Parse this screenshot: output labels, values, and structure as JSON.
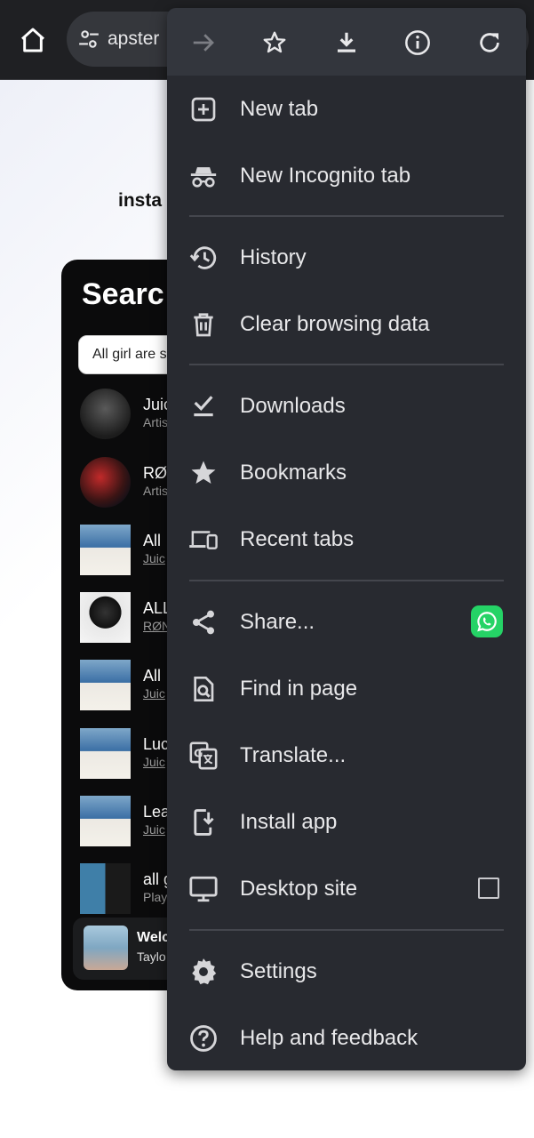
{
  "browser": {
    "url_text": "apster",
    "icons": [
      "home-icon",
      "site-settings-icon"
    ]
  },
  "page": {
    "install_text": "insta",
    "app": {
      "search_title": "Searc",
      "search_value": "All girl are s",
      "results": [
        {
          "title": "Juic",
          "sub": "Artis",
          "thumb": "avatar-dark"
        },
        {
          "title": "RØ",
          "sub": "Artis",
          "thumb": "avatar-red"
        },
        {
          "title": "All",
          "sub": "Juic",
          "thumb": "album-goodbye"
        },
        {
          "title": "ALL",
          "sub": "RØN",
          "thumb": "album-dark"
        },
        {
          "title": "All",
          "sub": "Juic",
          "thumb": "album-goodbye"
        },
        {
          "title": "Luc",
          "sub": "Juic",
          "thumb": "album-goodbye"
        },
        {
          "title": "Lea",
          "sub": "Juic",
          "thumb": "album-goodbye"
        },
        {
          "title": "all g",
          "sub": "Play",
          "thumb": "playlist-collage"
        }
      ],
      "player": {
        "title": "Welc",
        "sub": "Taylo"
      }
    }
  },
  "menu": {
    "header_icons": [
      "forward-icon",
      "bookmark-star-icon",
      "download-icon",
      "info-icon",
      "reload-icon"
    ],
    "items": [
      {
        "label": "New tab",
        "icon": "new-tab-icon"
      },
      {
        "label": "New Incognito tab",
        "icon": "incognito-icon"
      },
      {
        "label": "History",
        "icon": "history-icon"
      },
      {
        "label": "Clear browsing data",
        "icon": "trash-icon"
      },
      {
        "label": "Downloads",
        "icon": "downloads-icon"
      },
      {
        "label": "Bookmarks",
        "icon": "star-icon"
      },
      {
        "label": "Recent tabs",
        "icon": "devices-icon"
      },
      {
        "label": "Share...",
        "icon": "share-icon"
      },
      {
        "label": "Find in page",
        "icon": "find-icon"
      },
      {
        "label": "Translate...",
        "icon": "translate-icon"
      },
      {
        "label": "Install app",
        "icon": "install-icon"
      },
      {
        "label": "Desktop site",
        "icon": "desktop-icon"
      },
      {
        "label": "Settings",
        "icon": "gear-icon"
      },
      {
        "label": "Help and feedback",
        "icon": "help-icon"
      }
    ],
    "desktop_site_checked": false,
    "accent_colors": {
      "whatsapp": "#25d366",
      "menu_bg": "#282a30",
      "header_bg": "#33363d"
    }
  }
}
